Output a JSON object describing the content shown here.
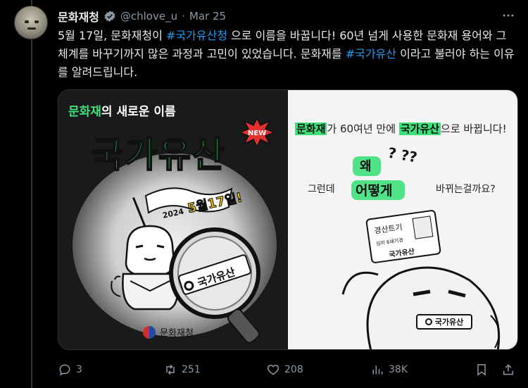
{
  "tweet": {
    "display_name": "문화재청",
    "handle": "@chlove_u",
    "separator": "·",
    "date": "Mar 25",
    "text_parts": [
      {
        "t": "5월 17일, 문화재청이 ",
        "tag": false
      },
      {
        "t": "#국가유산청",
        "tag": true
      },
      {
        "t": " 으로 이름을 바꿉니다! 60년 넘게 사용한 문화재 용어와 그 체계를 바꾸기까지 많은 과정과 고민이 있었습니다. 문화재를 ",
        "tag": false
      },
      {
        "t": "#국가유산",
        "tag": true
      },
      {
        "t": " 이라고 불러야 하는 이유를 알려드립니다.",
        "tag": false
      }
    ]
  },
  "media": {
    "left": {
      "subtitle_green": "문화재",
      "subtitle_rest": "의 새로운 이름",
      "title": "국가유산",
      "new_badge": "NEW",
      "flag_year": "2024",
      "flag_date": "5월17일!",
      "magnifier_label": "국가유산",
      "logo_text": "문화재청"
    },
    "right": {
      "hl1": "문화재",
      "mid1": "가 60여년 만에 ",
      "hl2": "국가유산",
      "end1": "으로 바뀝니다!",
      "q_left": "그런데",
      "why": "왜",
      "qmarks": "? ??",
      "how": "어떻게",
      "q_right": "바뀌는걸까요?",
      "card_title": "경산트기",
      "card_sub": "심미 6쇄기경",
      "card_name": "국가유산",
      "badge": "국가유산"
    }
  },
  "actions": {
    "replies": "3",
    "retweets": "251",
    "likes": "208",
    "views": "38K"
  },
  "colors": {
    "background": "#000000",
    "text": "#e7e9ea",
    "muted": "#8b98a5",
    "link": "#1d9bf0",
    "accent_green": "#3ee07a"
  },
  "icons": [
    "more-icon",
    "verified-icon",
    "reply-icon",
    "retweet-icon",
    "like-icon",
    "views-icon",
    "bookmark-icon",
    "share-icon"
  ]
}
